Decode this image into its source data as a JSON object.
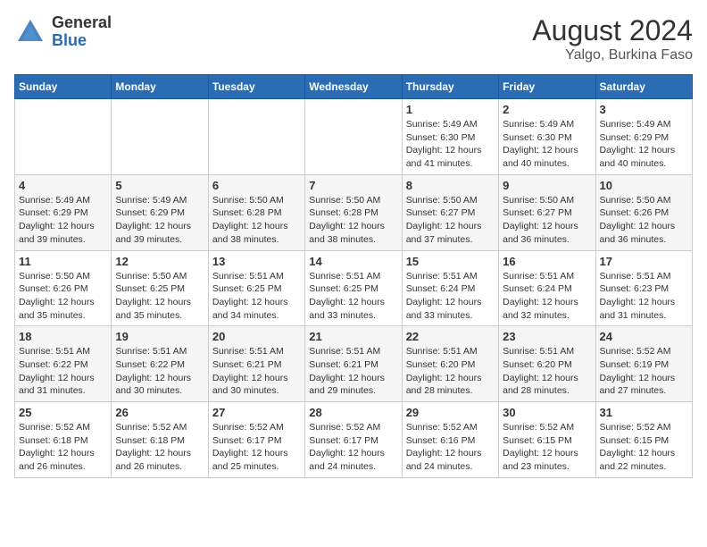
{
  "header": {
    "logo_general": "General",
    "logo_blue": "Blue",
    "title": "August 2024",
    "location": "Yalgo, Burkina Faso"
  },
  "days_of_week": [
    "Sunday",
    "Monday",
    "Tuesday",
    "Wednesday",
    "Thursday",
    "Friday",
    "Saturday"
  ],
  "weeks": [
    [
      {
        "day": "",
        "info": ""
      },
      {
        "day": "",
        "info": ""
      },
      {
        "day": "",
        "info": ""
      },
      {
        "day": "",
        "info": ""
      },
      {
        "day": "1",
        "info": "Sunrise: 5:49 AM\nSunset: 6:30 PM\nDaylight: 12 hours\nand 41 minutes."
      },
      {
        "day": "2",
        "info": "Sunrise: 5:49 AM\nSunset: 6:30 PM\nDaylight: 12 hours\nand 40 minutes."
      },
      {
        "day": "3",
        "info": "Sunrise: 5:49 AM\nSunset: 6:29 PM\nDaylight: 12 hours\nand 40 minutes."
      }
    ],
    [
      {
        "day": "4",
        "info": "Sunrise: 5:49 AM\nSunset: 6:29 PM\nDaylight: 12 hours\nand 39 minutes."
      },
      {
        "day": "5",
        "info": "Sunrise: 5:49 AM\nSunset: 6:29 PM\nDaylight: 12 hours\nand 39 minutes."
      },
      {
        "day": "6",
        "info": "Sunrise: 5:50 AM\nSunset: 6:28 PM\nDaylight: 12 hours\nand 38 minutes."
      },
      {
        "day": "7",
        "info": "Sunrise: 5:50 AM\nSunset: 6:28 PM\nDaylight: 12 hours\nand 38 minutes."
      },
      {
        "day": "8",
        "info": "Sunrise: 5:50 AM\nSunset: 6:27 PM\nDaylight: 12 hours\nand 37 minutes."
      },
      {
        "day": "9",
        "info": "Sunrise: 5:50 AM\nSunset: 6:27 PM\nDaylight: 12 hours\nand 36 minutes."
      },
      {
        "day": "10",
        "info": "Sunrise: 5:50 AM\nSunset: 6:26 PM\nDaylight: 12 hours\nand 36 minutes."
      }
    ],
    [
      {
        "day": "11",
        "info": "Sunrise: 5:50 AM\nSunset: 6:26 PM\nDaylight: 12 hours\nand 35 minutes."
      },
      {
        "day": "12",
        "info": "Sunrise: 5:50 AM\nSunset: 6:25 PM\nDaylight: 12 hours\nand 35 minutes."
      },
      {
        "day": "13",
        "info": "Sunrise: 5:51 AM\nSunset: 6:25 PM\nDaylight: 12 hours\nand 34 minutes."
      },
      {
        "day": "14",
        "info": "Sunrise: 5:51 AM\nSunset: 6:25 PM\nDaylight: 12 hours\nand 33 minutes."
      },
      {
        "day": "15",
        "info": "Sunrise: 5:51 AM\nSunset: 6:24 PM\nDaylight: 12 hours\nand 33 minutes."
      },
      {
        "day": "16",
        "info": "Sunrise: 5:51 AM\nSunset: 6:24 PM\nDaylight: 12 hours\nand 32 minutes."
      },
      {
        "day": "17",
        "info": "Sunrise: 5:51 AM\nSunset: 6:23 PM\nDaylight: 12 hours\nand 31 minutes."
      }
    ],
    [
      {
        "day": "18",
        "info": "Sunrise: 5:51 AM\nSunset: 6:22 PM\nDaylight: 12 hours\nand 31 minutes."
      },
      {
        "day": "19",
        "info": "Sunrise: 5:51 AM\nSunset: 6:22 PM\nDaylight: 12 hours\nand 30 minutes."
      },
      {
        "day": "20",
        "info": "Sunrise: 5:51 AM\nSunset: 6:21 PM\nDaylight: 12 hours\nand 30 minutes."
      },
      {
        "day": "21",
        "info": "Sunrise: 5:51 AM\nSunset: 6:21 PM\nDaylight: 12 hours\nand 29 minutes."
      },
      {
        "day": "22",
        "info": "Sunrise: 5:51 AM\nSunset: 6:20 PM\nDaylight: 12 hours\nand 28 minutes."
      },
      {
        "day": "23",
        "info": "Sunrise: 5:51 AM\nSunset: 6:20 PM\nDaylight: 12 hours\nand 28 minutes."
      },
      {
        "day": "24",
        "info": "Sunrise: 5:52 AM\nSunset: 6:19 PM\nDaylight: 12 hours\nand 27 minutes."
      }
    ],
    [
      {
        "day": "25",
        "info": "Sunrise: 5:52 AM\nSunset: 6:18 PM\nDaylight: 12 hours\nand 26 minutes."
      },
      {
        "day": "26",
        "info": "Sunrise: 5:52 AM\nSunset: 6:18 PM\nDaylight: 12 hours\nand 26 minutes."
      },
      {
        "day": "27",
        "info": "Sunrise: 5:52 AM\nSunset: 6:17 PM\nDaylight: 12 hours\nand 25 minutes."
      },
      {
        "day": "28",
        "info": "Sunrise: 5:52 AM\nSunset: 6:17 PM\nDaylight: 12 hours\nand 24 minutes."
      },
      {
        "day": "29",
        "info": "Sunrise: 5:52 AM\nSunset: 6:16 PM\nDaylight: 12 hours\nand 24 minutes."
      },
      {
        "day": "30",
        "info": "Sunrise: 5:52 AM\nSunset: 6:15 PM\nDaylight: 12 hours\nand 23 minutes."
      },
      {
        "day": "31",
        "info": "Sunrise: 5:52 AM\nSunset: 6:15 PM\nDaylight: 12 hours\nand 22 minutes."
      }
    ]
  ]
}
